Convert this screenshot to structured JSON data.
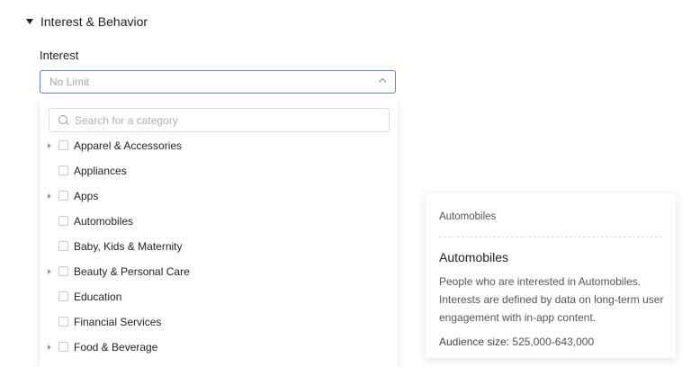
{
  "section": {
    "title": "Interest & Behavior"
  },
  "interest": {
    "label": "Interest",
    "select_value": "No Limit",
    "search_placeholder": "Search for a category",
    "categories": [
      {
        "label": "Apparel & Accessories",
        "expandable": true
      },
      {
        "label": "Appliances",
        "expandable": false
      },
      {
        "label": "Apps",
        "expandable": true
      },
      {
        "label": "Automobiles",
        "expandable": false
      },
      {
        "label": "Baby, Kids & Maternity",
        "expandable": false
      },
      {
        "label": "Beauty & Personal Care",
        "expandable": true
      },
      {
        "label": "Education",
        "expandable": false
      },
      {
        "label": "Financial Services",
        "expandable": false
      },
      {
        "label": "Food & Beverage",
        "expandable": true
      }
    ]
  },
  "tooltip": {
    "breadcrumb": "Automobiles",
    "title": "Automobiles",
    "description": "People who are interested in Automobiles. Interests are defined by data on long-term user engagement with in-app content.",
    "audience_label": "Audience size:",
    "audience_value": "525,000-643,000"
  }
}
